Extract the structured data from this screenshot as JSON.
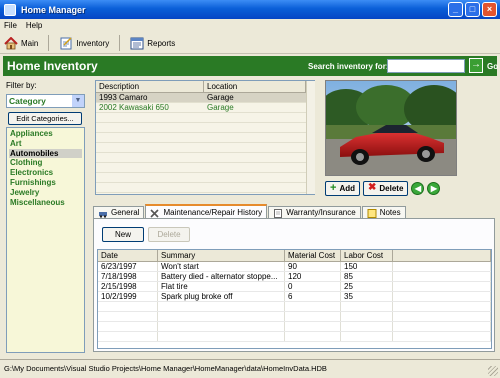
{
  "window": {
    "title": "Home Manager",
    "minimize": "_",
    "maximize": "□",
    "close": "×"
  },
  "menu": {
    "items": [
      "File",
      "Help"
    ]
  },
  "toolbar": {
    "main": "Main",
    "inventory": "Inventory",
    "reports": "Reports"
  },
  "header": {
    "title": "Home Inventory",
    "search_label": "Search inventory for:",
    "search_value": "",
    "go_label": "Go",
    "go_arrow": "→"
  },
  "filter": {
    "label": "Filter by:",
    "selected": "Category",
    "edit_button": "Edit Categories...",
    "categories": [
      "Appliances",
      "Art",
      "Automobiles",
      "Clothing",
      "Electronics",
      "Furnishings",
      "Jewelry",
      "Miscellaneous"
    ],
    "selected_category": "Automobiles"
  },
  "inventory": {
    "columns": [
      "Description",
      "Location"
    ],
    "rows": [
      {
        "description": "1993 Camaro",
        "location": "Garage"
      },
      {
        "description": "2002 Kawasaki 650",
        "location": "Garage"
      }
    ]
  },
  "photo_actions": {
    "add": "Add",
    "delete": "Delete",
    "plus": "+",
    "x": "✖",
    "prev": "◀",
    "next": "▶"
  },
  "tabs": [
    {
      "label": "General",
      "active": false
    },
    {
      "label": "Maintenance/Repair History",
      "active": true
    },
    {
      "label": "Warranty/Insurance",
      "active": false
    },
    {
      "label": "Notes",
      "active": false
    }
  ],
  "maintenance": {
    "new_button": "New",
    "delete_button": "Delete",
    "columns": [
      "Date",
      "Summary",
      "Material Cost",
      "Labor Cost"
    ],
    "rows": [
      {
        "date": "6/23/1997",
        "summary": "Won't start",
        "material": "90",
        "labor": "150"
      },
      {
        "date": "7/18/1998",
        "summary": "Battery died - alternator stoppe...",
        "material": "120",
        "labor": "85"
      },
      {
        "date": "2/15/1998",
        "summary": "Flat tire",
        "material": "0",
        "labor": "25"
      },
      {
        "date": "10/2/1999",
        "summary": "Spark plug broke off",
        "material": "6",
        "labor": "35"
      }
    ]
  },
  "status": {
    "path": "G:\\My Documents\\Visual Studio Projects\\Home Manager\\HomeManager\\data\\HomeInvData.HDB"
  },
  "colors": {
    "brand_green": "#2a7a25",
    "title_blue": "#0a5fd8",
    "tab_accent": "#e68b2c"
  }
}
